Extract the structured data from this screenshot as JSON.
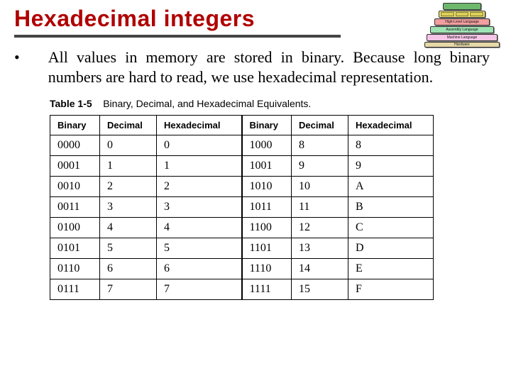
{
  "title": "Hexadecimal integers",
  "bullet": "•",
  "body": "All values in memory are stored in binary. Because long binary numbers are hard to read, we use hexadecimal representation.",
  "table_caption_label": "Table 1-5",
  "table_caption_text": "Binary, Decimal, and Hexadecimal Equivalents.",
  "headers": {
    "binary": "Binary",
    "decimal": "Decimal",
    "hexadecimal": "Hexadecimal"
  },
  "chart_data": {
    "type": "table",
    "title": "Binary, Decimal, and Hexadecimal Equivalents",
    "columns": [
      "Binary",
      "Decimal",
      "Hexadecimal"
    ],
    "rows": [
      {
        "binary": "0000",
        "decimal": "0",
        "hex": "0"
      },
      {
        "binary": "0001",
        "decimal": "1",
        "hex": "1"
      },
      {
        "binary": "0010",
        "decimal": "2",
        "hex": "2"
      },
      {
        "binary": "0011",
        "decimal": "3",
        "hex": "3"
      },
      {
        "binary": "0100",
        "decimal": "4",
        "hex": "4"
      },
      {
        "binary": "0101",
        "decimal": "5",
        "hex": "5"
      },
      {
        "binary": "0110",
        "decimal": "6",
        "hex": "6"
      },
      {
        "binary": "0111",
        "decimal": "7",
        "hex": "7"
      },
      {
        "binary": "1000",
        "decimal": "8",
        "hex": "8"
      },
      {
        "binary": "1001",
        "decimal": "9",
        "hex": "9"
      },
      {
        "binary": "1010",
        "decimal": "10",
        "hex": "A"
      },
      {
        "binary": "1011",
        "decimal": "11",
        "hex": "B"
      },
      {
        "binary": "1100",
        "decimal": "12",
        "hex": "C"
      },
      {
        "binary": "1101",
        "decimal": "13",
        "hex": "D"
      },
      {
        "binary": "1110",
        "decimal": "14",
        "hex": "E"
      },
      {
        "binary": "1111",
        "decimal": "15",
        "hex": "F"
      }
    ]
  },
  "pyramid_layers": {
    "l3": "High-Level Language",
    "l4": "Assembly Language",
    "l5": "Machine Language",
    "l6": "Hardware"
  }
}
